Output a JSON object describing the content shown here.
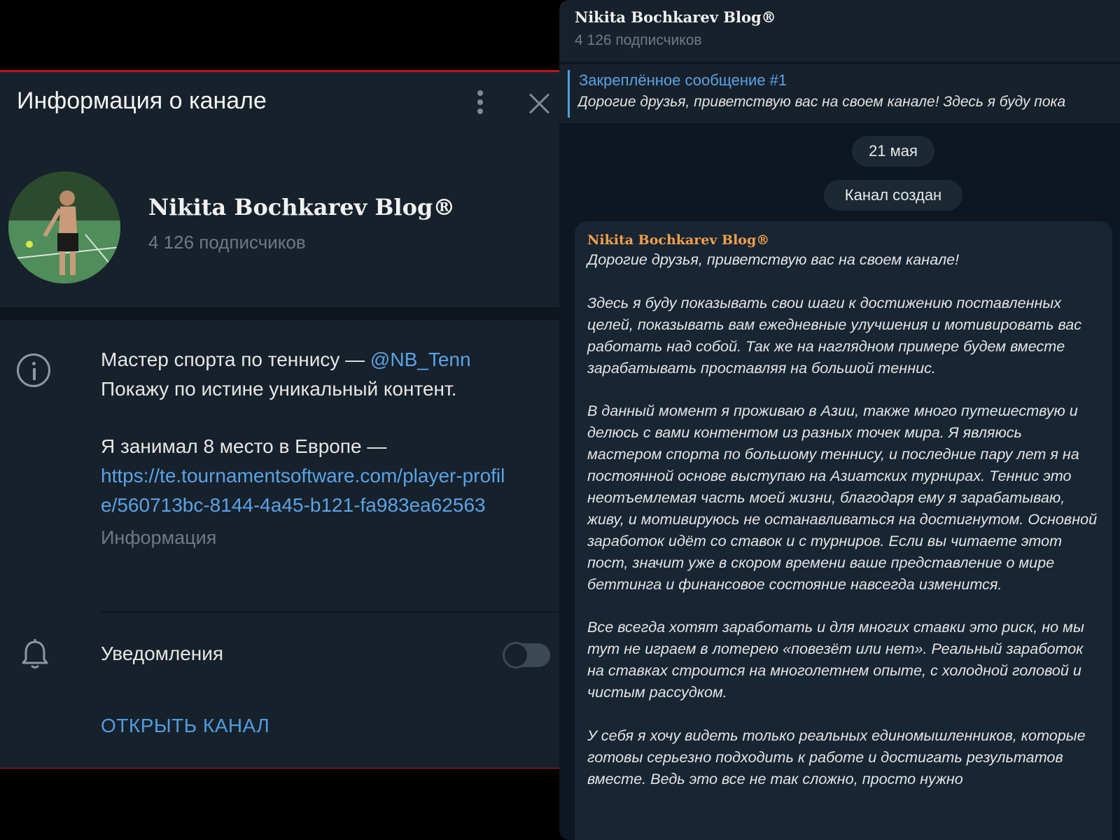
{
  "info_panel": {
    "title": "Информация о канале",
    "channel": {
      "name": "Nikita Bochkarev Blog®",
      "subscribers": "4 126 подписчиков"
    },
    "about": {
      "line1_text": "Мастер спорта по теннису — ",
      "line1_link": "@NB_Tenn",
      "line2": "Покажу по истине уникальный контент.",
      "line3": "Я занимал 8 место в Европе —",
      "profile_link": "https://te.tournamentsoftware.com/player-profile/560713bc-8144-4a45-b121-fa983ea62563",
      "caption": "Информация"
    },
    "notifications": {
      "label": "Уведомления",
      "enabled": false
    },
    "open_channel_label": "ОТКРЫТЬ КАНАЛ"
  },
  "chat": {
    "header": {
      "title": "Nikita Bochkarev Blog®",
      "subscribers": "4 126 подписчиков"
    },
    "pinned": {
      "title": "Закреплённое сообщение #1",
      "preview": "Дорогие друзья, приветствую вас на своем канале!  Здесь я буду пока"
    },
    "date_label": "21 мая",
    "service_message": "Канал создан",
    "message": {
      "author": "Nikita Bochkarev Blog®",
      "text": "Дорогие друзья, приветствую вас на своем канале!\n\nЗдесь я буду показывать свои шаги к достижению поставленных целей, показывать вам ежедневные улучшения и мотивировать вас работать над собой. Так же на наглядном примере будем вместе зарабатывать проставляя на большой теннис.\n\nВ данный момент я проживаю в Азии, также много путешествую и делюсь с вами контентом из разных точек мира. Я являюсь мастером спорта по большому теннису, и последние пару лет я на постоянной основе выступаю на Азиатских турнирах. Теннис это неотъемлемая часть моей жизни, благодаря ему я зарабатываю, живу, и мотивируюсь не останавливаться на достигнутом. Основной заработок идёт со ставок и с турниров. Если вы читаете этот пост, значит уже в скором времени ваше представление о мире беттинга и финансовое состояние навсегда изменится.\n\nВсе всегда хотят заработать и для многих ставки это риск, но мы тут не играем в лотерею «повезёт или нет». Реальный заработок на ставках строится на многолетнем опыте, с холодной головой и чистым рассудком.\n\nУ себя я хочу видеть только реальных единомышленников, которые готовы серьезно подходить к работе и достигать результатов вместе. Ведь это все не так сложно, просто нужно"
    }
  },
  "colors": {
    "panel_bg": "#17212b",
    "chat_bg": "#0e1621",
    "link": "#5aa3e6",
    "author": "#f0a04b",
    "frame_red": "#c0131f"
  }
}
